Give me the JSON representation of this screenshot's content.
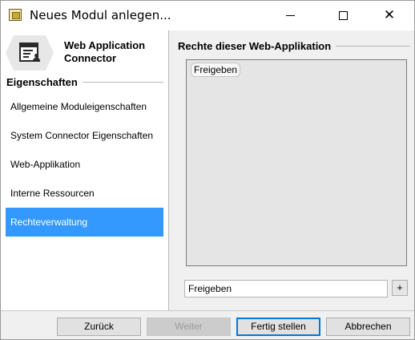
{
  "window": {
    "title": "Neues Modul anlegen..."
  },
  "module": {
    "name": "Web Application Connector",
    "icon": "web-application-connector-icon"
  },
  "sidebar": {
    "section_title": "Eigenschaften",
    "items": [
      {
        "label": "Allgemeine Moduleigenschaften",
        "active": false
      },
      {
        "label": "System Connector Eigenschaften",
        "active": false
      },
      {
        "label": "Web-Applikation",
        "active": false
      },
      {
        "label": "Interne Ressourcen",
        "active": false
      },
      {
        "label": "Rechteverwaltung",
        "active": true
      }
    ]
  },
  "rights": {
    "section_title": "Rechte dieser Web-Applikation",
    "entries": [
      "Freigeben"
    ],
    "input_value": "Freigeben",
    "add_label": "+"
  },
  "footer": {
    "back_label": "Zurück",
    "next_label": "Weiter",
    "finish_label": "Fertig stellen",
    "cancel_label": "Abbrechen"
  },
  "colors": {
    "active_item": "#3399ff",
    "panel_bg": "#f0f0f0",
    "list_bg": "#e5e5e5"
  }
}
